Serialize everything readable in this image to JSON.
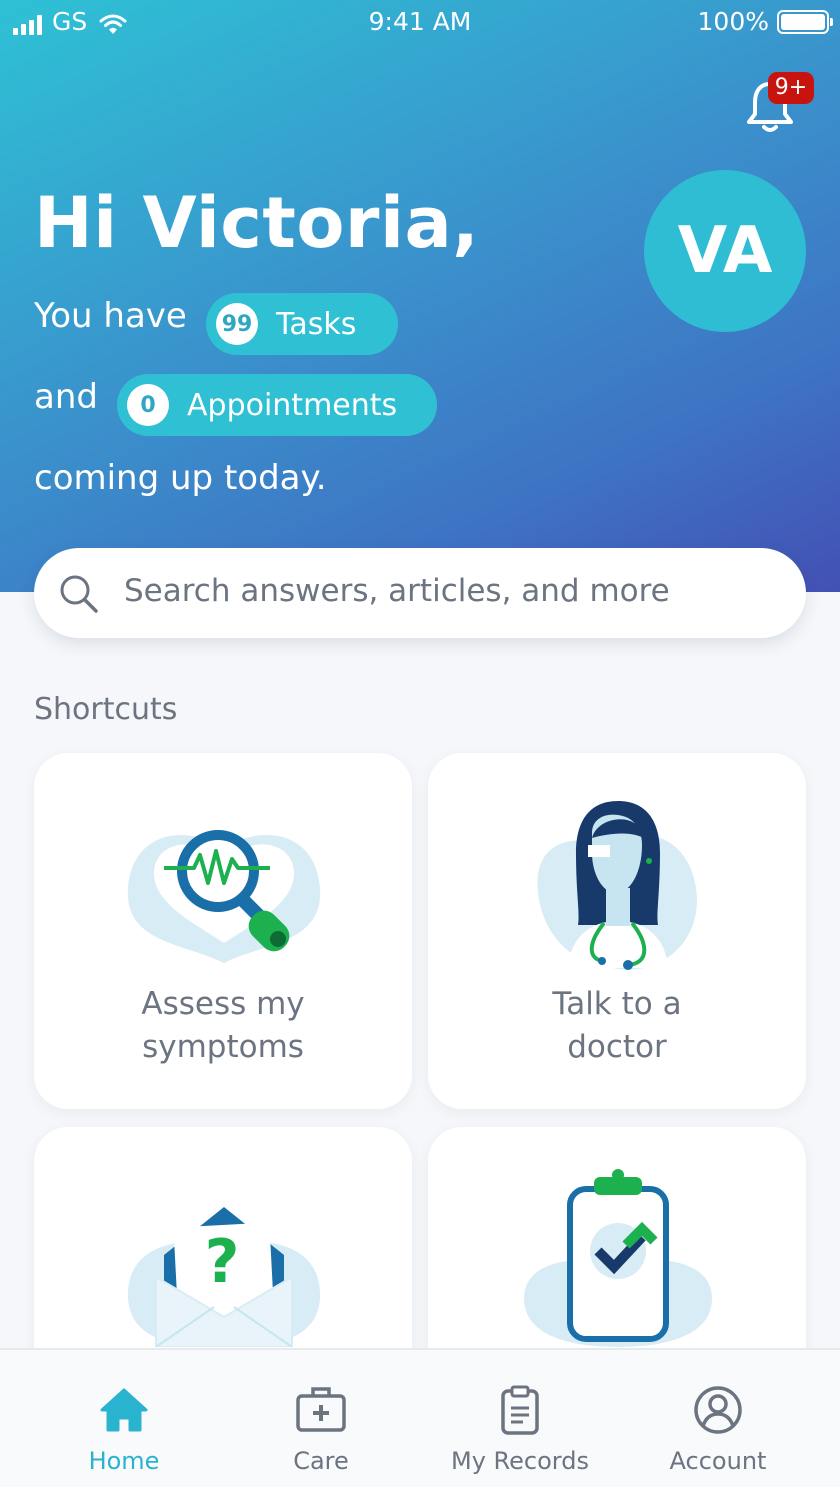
{
  "status_bar": {
    "carrier": "GS",
    "time": "9:41 AM",
    "battery": "100%"
  },
  "notifications": {
    "badge": "9+"
  },
  "greeting": {
    "title": "Hi Victoria,",
    "avatar_initials": "VA",
    "line1_prefix": "You have",
    "tasks_count": "99",
    "tasks_label": "Tasks",
    "line2_prefix": "and",
    "appointments_count": "0",
    "appointments_label": "Appointments",
    "line3": "coming up today."
  },
  "search": {
    "placeholder": "Search answers, articles, and more"
  },
  "shortcuts": {
    "title": "Shortcuts",
    "items": [
      {
        "label_line1": "Assess my",
        "label_line2": "symptoms",
        "icon": "magnifier-heart-icon"
      },
      {
        "label_line1": "Talk to a",
        "label_line2": "doctor",
        "icon": "doctor-icon"
      },
      {
        "label_line1": "",
        "label_line2": "",
        "icon": "question-envelope-icon"
      },
      {
        "label_line1": "",
        "label_line2": "",
        "icon": "clipboard-check-icon"
      }
    ]
  },
  "tabbar": {
    "items": [
      {
        "label": "Home",
        "icon": "home-icon",
        "active": true
      },
      {
        "label": "Care",
        "icon": "medical-kit-icon",
        "active": false
      },
      {
        "label": "My Records",
        "icon": "clipboard-icon",
        "active": false
      },
      {
        "label": "Account",
        "icon": "user-icon",
        "active": false
      }
    ]
  },
  "colors": {
    "accent": "#2fc0d3",
    "gradient_start": "#2ec1d5",
    "gradient_end": "#4350b4",
    "badge": "#c8140f",
    "illustration_green": "#1cb04f",
    "illustration_blue": "#1a6fa8"
  }
}
